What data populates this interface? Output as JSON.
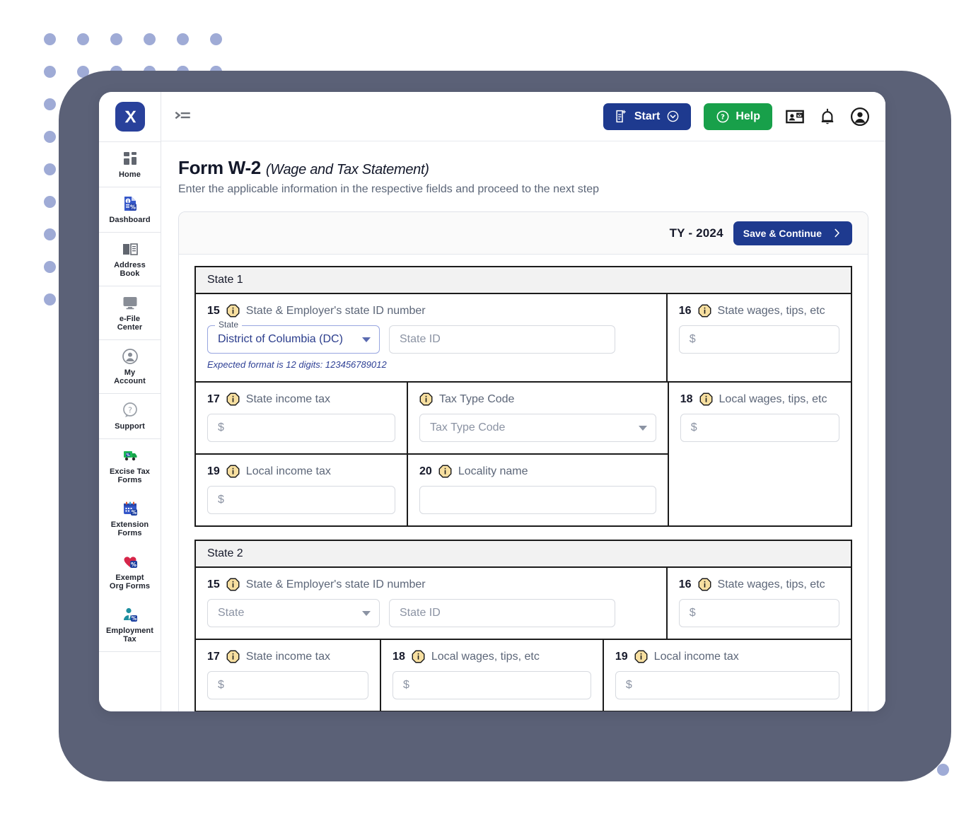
{
  "brand": {
    "logo_text": "X",
    "logo_color": "#29419b"
  },
  "sidebar": {
    "items": [
      {
        "label": "Home",
        "icon": "grid-icon"
      },
      {
        "label": "Dashboard",
        "icon": "dashboard-report-icon"
      },
      {
        "label": "Address\nBook",
        "icon": "address-book-icon"
      },
      {
        "label": "e-File\nCenter",
        "icon": "monitor-icon"
      },
      {
        "label": "My\nAccount",
        "icon": "user-circle-icon"
      },
      {
        "label": "Support",
        "icon": "question-bubble-icon"
      },
      {
        "label": "Excise Tax\nForms",
        "icon": "truck-icon"
      },
      {
        "label": "Extension\nForms",
        "icon": "calendar-icon"
      },
      {
        "label": "Exempt\nOrg Forms",
        "icon": "heart-icon"
      },
      {
        "label": "Employment\nTax",
        "icon": "person-badge-icon"
      }
    ]
  },
  "topbar": {
    "menu_icon": "menu-expand-icon",
    "start_label": "Start",
    "help_label": "Help",
    "contact_card_icon": "contact-card-icon",
    "bell_icon": "bell-icon",
    "account_icon": "account-circle-icon"
  },
  "header": {
    "title": "Form W-2",
    "subtitle": "(Wage and Tax Statement)",
    "description": "Enter the applicable information in the respective fields and proceed to the next step"
  },
  "card": {
    "tax_year": "TY - 2024",
    "save_label": "Save & Continue"
  },
  "states": [
    {
      "title": "State 1",
      "f15": {
        "num": "15",
        "label": "State & Employer's state ID number",
        "state_legend": "State",
        "state_value": "District of Columbia (DC)",
        "state_id_placeholder": "State ID",
        "hint": "Expected format is 12 digits: 123456789012"
      },
      "f16": {
        "num": "16",
        "label": "State wages, tips, etc",
        "placeholder": "$"
      },
      "f17": {
        "num": "17",
        "label": "State income tax",
        "placeholder": "$"
      },
      "tax_type": {
        "num": "",
        "label": "Tax Type Code",
        "placeholder": "Tax Type Code"
      },
      "f18": {
        "num": "18",
        "label": "Local wages, tips, etc",
        "placeholder": "$"
      },
      "f19": {
        "num": "19",
        "label": "Local income tax",
        "placeholder": "$"
      },
      "f20": {
        "num": "20",
        "label": "Locality name",
        "placeholder": ""
      }
    },
    {
      "title": "State 2",
      "f15": {
        "num": "15",
        "label": "State & Employer's state ID number",
        "state_placeholder": "State",
        "state_id_placeholder": "State ID"
      },
      "f16": {
        "num": "16",
        "label": "State wages, tips, etc",
        "placeholder": "$"
      },
      "f17": {
        "num": "17",
        "label": "State income tax",
        "placeholder": "$"
      },
      "f18": {
        "num": "18",
        "label": "Local wages, tips, etc",
        "placeholder": "$"
      },
      "f19": {
        "num": "19",
        "label": "Local income tax",
        "placeholder": "$"
      }
    }
  ]
}
